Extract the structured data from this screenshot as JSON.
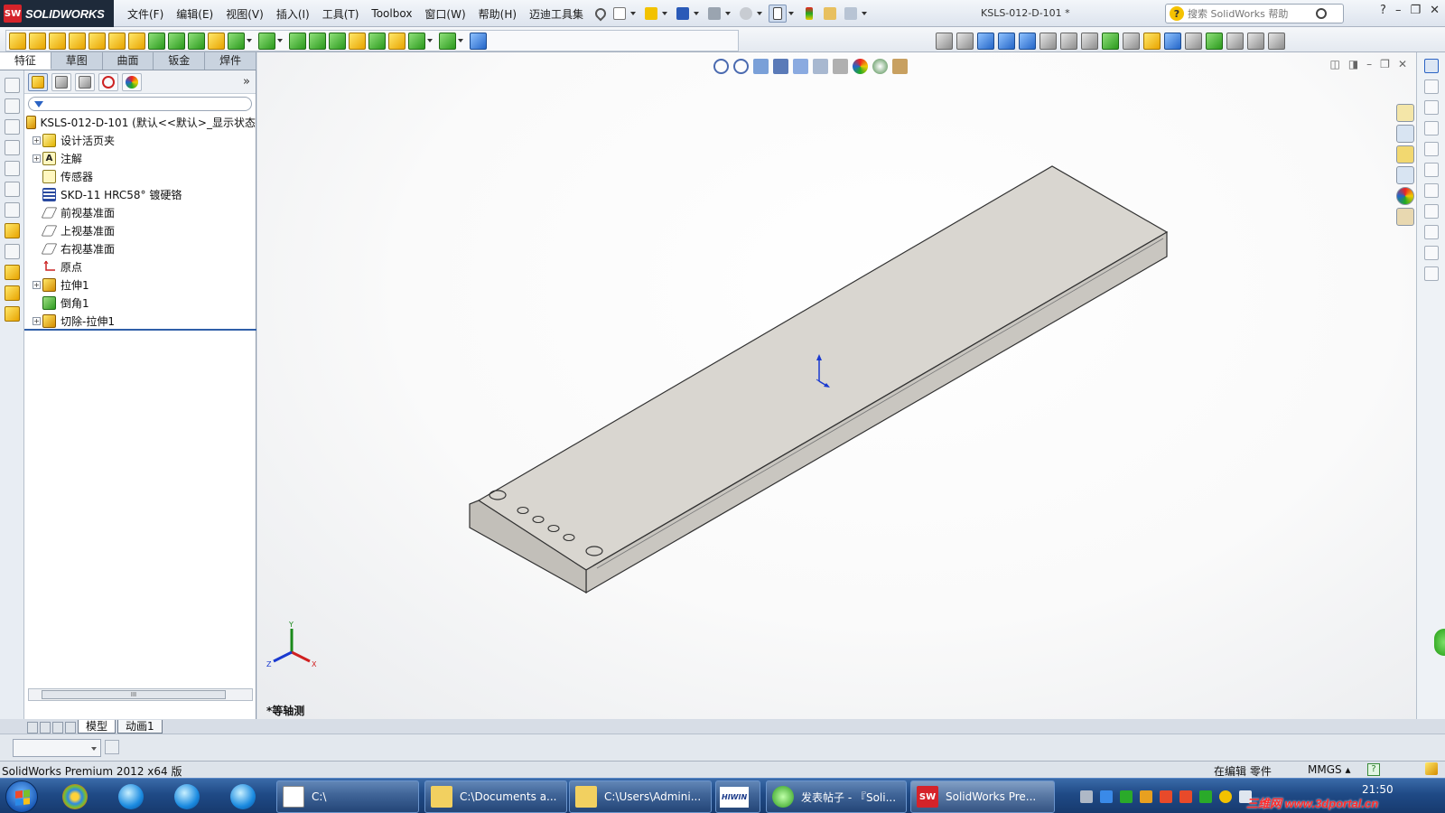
{
  "app": {
    "brand": "SOLIDWORKS",
    "brand_mark": "SW",
    "menus": [
      "文件(F)",
      "编辑(E)",
      "视图(V)",
      "插入(I)",
      "工具(T)",
      "Toolbox",
      "窗口(W)",
      "帮助(H)",
      "迈迪工具集"
    ],
    "doc_title": "KSLS-012-D-101 *",
    "help_search_placeholder": "搜索 SolidWorks 帮助",
    "help_q": "?",
    "window_controls": [
      "?",
      "–",
      "❐",
      "✕"
    ]
  },
  "feature_tabs": [
    "特征",
    "草图",
    "曲面",
    "钣金",
    "焊件"
  ],
  "tree": {
    "root_label": "KSLS-012-D-101  (默认<<默认>_显示状态",
    "expander": "+",
    "items": [
      {
        "label": "设计活页夹",
        "icon": "folder-icon",
        "expandable": true
      },
      {
        "label": "注解",
        "icon": "annotation-icon",
        "expandable": true
      },
      {
        "label": "传感器",
        "icon": "sensor-icon",
        "expandable": false
      },
      {
        "label": "SKD-11 HRC58°  镀硬铬",
        "icon": "material-icon",
        "expandable": false
      },
      {
        "label": "前视基准面",
        "icon": "plane-icon",
        "expandable": false
      },
      {
        "label": "上视基准面",
        "icon": "plane-icon",
        "expandable": false
      },
      {
        "label": "右视基准面",
        "icon": "plane-icon",
        "expandable": false
      },
      {
        "label": "原点",
        "icon": "origin-icon",
        "expandable": false
      },
      {
        "label": "拉伸1",
        "icon": "extrude-icon",
        "expandable": true
      },
      {
        "label": "倒角1",
        "icon": "chamfer-icon",
        "expandable": false
      },
      {
        "label": "切除-拉伸1",
        "icon": "cut-extrude-icon",
        "expandable": true
      }
    ]
  },
  "scroll_grip": "III",
  "more_glyph": "»",
  "model_tabs": [
    "模型",
    "动画1"
  ],
  "viewport": {
    "view_name": "*等轴测",
    "triad": {
      "x": "X",
      "y": "Y",
      "z": "Z"
    },
    "controls": [
      "◫",
      "◨",
      "–",
      "❐",
      "✕"
    ]
  },
  "status": {
    "product": "SolidWorks Premium 2012 x64 版",
    "edit_mode": "在编辑 零件",
    "units": "MMGS  ▴",
    "help": "?"
  },
  "taskbar": {
    "buttons": [
      {
        "label": "C:\\",
        "icon": "console-icon"
      },
      {
        "label": "C:\\Documents a...",
        "icon": "folder-icon"
      },
      {
        "label": "C:\\Users\\Admini...",
        "icon": "folder-icon"
      },
      {
        "label": "HIWIN",
        "icon": "hiwin-icon"
      },
      {
        "label": "发表帖子 - 『Soli...",
        "icon": "browser-icon"
      },
      {
        "label": "SolidWorks Pre...",
        "icon": "solidworks-icon"
      }
    ],
    "clock": "21:50",
    "watermark": "三维网 www.3dportal.cn"
  },
  "colors": {
    "part_top": "#d9d6d0",
    "part_side": "#c2bfb9",
    "part_front": "#ccc9c3",
    "accent": "#2f5fa8",
    "sw_red": "#d5232a"
  }
}
